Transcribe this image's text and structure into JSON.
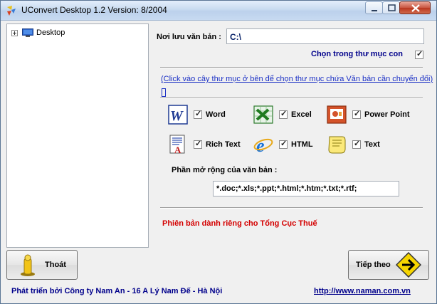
{
  "window": {
    "title": "UConvert Desktop 1.2   Version: 8/2004"
  },
  "tree": {
    "items": [
      {
        "label": "Desktop"
      }
    ]
  },
  "settings": {
    "save_label": "Nơi lưu văn bản :",
    "save_path": "C:\\",
    "subfolder_label": "Chọn trong thư mục con",
    "subfolder_checked": true,
    "hint": "(Click vào cây thư mục ở bên để chọn thư mục chứa Văn bản cần chuyển đổi)"
  },
  "file_types": [
    {
      "label": "Word",
      "icon": "word-icon",
      "checked": true
    },
    {
      "label": "Excel",
      "icon": "excel-icon",
      "checked": true
    },
    {
      "label": "Power Point",
      "icon": "powerpoint-icon",
      "checked": true
    },
    {
      "label": "Rich Text",
      "icon": "rich-text-icon",
      "checked": true
    },
    {
      "label": "HTML",
      "icon": "html-icon",
      "checked": true
    },
    {
      "label": "Text",
      "icon": "text-icon",
      "checked": true
    }
  ],
  "extensions": {
    "label": "Phần mở rộng của văn bản :",
    "value": "*.doc;*.xls;*.ppt;*.html;*.htm;*.txt;*.rtf;"
  },
  "edition_note": "Phiên bản dành riêng cho Tổng Cục Thuế",
  "buttons": {
    "exit_label": "Thoát",
    "next_label": "Tiếp theo"
  },
  "footer": {
    "developer": "Phát triển bởi Công ty Nam An - 16 A Lý Nam Đế - Hà Nội",
    "website": "http://www.naman.com.vn"
  },
  "colors": {
    "link": "#1a2fc5",
    "dark_blue_text": "#00008b",
    "edition_red": "#d40000"
  }
}
